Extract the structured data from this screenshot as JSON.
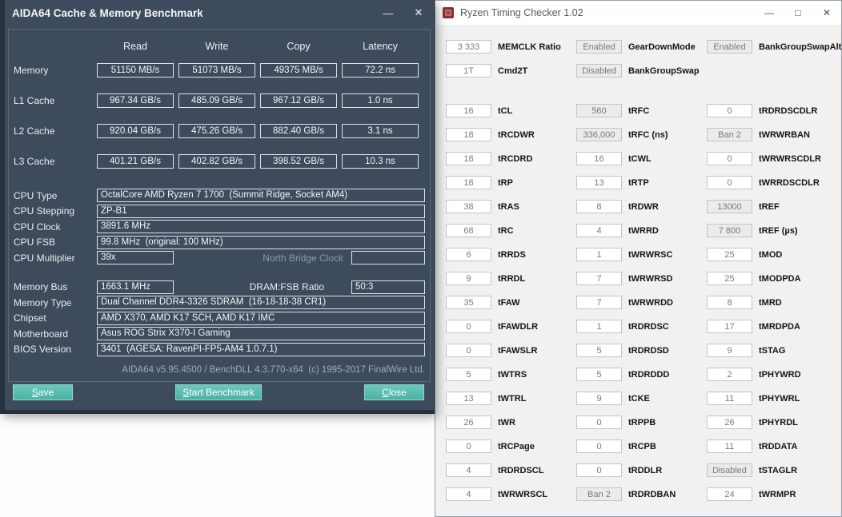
{
  "aida": {
    "title": "AIDA64 Cache & Memory Benchmark",
    "window_controls": {
      "minimize": "—",
      "close": "✕"
    },
    "columns": [
      "Read",
      "Write",
      "Copy",
      "Latency"
    ],
    "bench_rows": [
      {
        "label": "Memory",
        "read": "51150 MB/s",
        "write": "51073 MB/s",
        "copy": "49375 MB/s",
        "latency": "72.2 ns"
      },
      {
        "label": "L1 Cache",
        "read": "967.34 GB/s",
        "write": "485.09 GB/s",
        "copy": "967.12 GB/s",
        "latency": "1.0 ns"
      },
      {
        "label": "L2 Cache",
        "read": "920.04 GB/s",
        "write": "475.26 GB/s",
        "copy": "882.40 GB/s",
        "latency": "3.1 ns"
      },
      {
        "label": "L3 Cache",
        "read": "401.21 GB/s",
        "write": "402.82 GB/s",
        "copy": "398.52 GB/s",
        "latency": "10.3 ns"
      }
    ],
    "info_rows_a": [
      {
        "label": "CPU Type",
        "value": "OctalCore AMD Ryzen 7 1700  (Summit Ridge, Socket AM4)"
      },
      {
        "label": "CPU Stepping",
        "value": "ZP-B1"
      },
      {
        "label": "CPU Clock",
        "value": "3891.6 MHz"
      },
      {
        "label": "CPU FSB",
        "value": "99.8 MHz  (original: 100 MHz)"
      }
    ],
    "multiplier_row": {
      "label": "CPU Multiplier",
      "value": "39x",
      "nb_label": "North Bridge Clock",
      "nb_value": ""
    },
    "membus_row": {
      "label": "Memory Bus",
      "value": "1663.1 MHz",
      "ratio_label": "DRAM:FSB Ratio",
      "ratio_value": "50:3"
    },
    "info_rows_b": [
      {
        "label": "Memory Type",
        "value": "Dual Channel DDR4-3326 SDRAM  (16-18-18-38 CR1)"
      },
      {
        "label": "Chipset",
        "value": "AMD X370, AMD K17 SCH, AMD K17 IMC"
      },
      {
        "label": "Motherboard",
        "value": "Asus ROG Strix X370-I Gaming"
      },
      {
        "label": "BIOS Version",
        "value": "3401  (AGESA: RavenPI-FP5-AM4 1.0.7.1)"
      }
    ],
    "footer": "AIDA64 v5.95.4500 / BenchDLL 4.3.770-x64  (c) 1995-2017 FinalWire Ltd.",
    "buttons": {
      "save": "Save",
      "start": "Start Benchmark",
      "close": "Close"
    },
    "colors": {
      "window_bg": "#3d4b5c",
      "button_teal": "#4cb1a4",
      "box_border": "#e0e5ea"
    }
  },
  "rtc": {
    "title": "Ryzen Timing Checker 1.02",
    "window_controls": {
      "minimize": "—",
      "maximize": "□",
      "close": "✕"
    },
    "colors": {
      "titlebar_bg": "#ffffff",
      "body_bg": "#f1f1f1",
      "muted_box": "#ebebeb"
    },
    "top_col1": [
      {
        "value": "3 333",
        "label": "MEMCLK Ratio"
      },
      {
        "value": "1T",
        "label": "Cmd2T"
      }
    ],
    "top_col2": [
      {
        "value": "Enabled",
        "label": "GearDownMode",
        "muted": true
      },
      {
        "value": "Disabled",
        "label": "BankGroupSwap",
        "muted": true
      }
    ],
    "top_col3": [
      {
        "value": "Enabled",
        "label": "BankGroupSwapAlt",
        "muted": true
      }
    ],
    "col1": [
      {
        "value": "16",
        "label": "tCL"
      },
      {
        "value": "18",
        "label": "tRCDWR"
      },
      {
        "value": "18",
        "label": "tRCDRD"
      },
      {
        "value": "18",
        "label": "tRP"
      },
      {
        "value": "38",
        "label": "tRAS"
      },
      {
        "value": "68",
        "label": "tRC"
      },
      {
        "value": "6",
        "label": "tRRDS"
      },
      {
        "value": "9",
        "label": "tRRDL"
      },
      {
        "value": "35",
        "label": "tFAW"
      },
      {
        "value": "0",
        "label": "tFAWDLR"
      },
      {
        "value": "0",
        "label": "tFAWSLR"
      },
      {
        "value": "5",
        "label": "tWTRS"
      },
      {
        "value": "13",
        "label": "tWTRL"
      },
      {
        "value": "26",
        "label": "tWR"
      },
      {
        "value": "0",
        "label": "tRCPage"
      },
      {
        "value": "4",
        "label": "tRDRDSCL"
      },
      {
        "value": "4",
        "label": "tWRWRSCL"
      }
    ],
    "col2": [
      {
        "value": "560",
        "label": "tRFC",
        "muted": true
      },
      {
        "value": "336,000",
        "label": "tRFC (ns)",
        "muted": true
      },
      {
        "value": "16",
        "label": "tCWL"
      },
      {
        "value": "13",
        "label": "tRTP"
      },
      {
        "value": "8",
        "label": "tRDWR"
      },
      {
        "value": "4",
        "label": "tWRRD"
      },
      {
        "value": "1",
        "label": "tWRWRSC"
      },
      {
        "value": "7",
        "label": "tWRWRSD"
      },
      {
        "value": "7",
        "label": "tWRWRDD"
      },
      {
        "value": "1",
        "label": "tRDRDSC"
      },
      {
        "value": "5",
        "label": "tRDRDSD"
      },
      {
        "value": "5",
        "label": "tRDRDDD"
      },
      {
        "value": "9",
        "label": "tCKE"
      },
      {
        "value": "0",
        "label": "tRPPB"
      },
      {
        "value": "0",
        "label": "tRCPB"
      },
      {
        "value": "0",
        "label": "tRDDLR"
      },
      {
        "value": "Ban 2",
        "label": "tRDRDBAN",
        "muted": true
      }
    ],
    "col3": [
      {
        "value": "0",
        "label": "tRDRDSCDLR"
      },
      {
        "value": "Ban 2",
        "label": "tWRWRBAN",
        "muted": true
      },
      {
        "value": "0",
        "label": "tWRWRSCDLR"
      },
      {
        "value": "0",
        "label": "tWRRDSCDLR"
      },
      {
        "value": "13000",
        "label": "tREF",
        "muted": true
      },
      {
        "value": "7 800",
        "label": "tREF (µs)",
        "muted": true
      },
      {
        "value": "25",
        "label": "tMOD"
      },
      {
        "value": "25",
        "label": "tMODPDA"
      },
      {
        "value": "8",
        "label": "tMRD"
      },
      {
        "value": "17",
        "label": "tMRDPDA"
      },
      {
        "value": "9",
        "label": "tSTAG"
      },
      {
        "value": "2",
        "label": "tPHYWRD"
      },
      {
        "value": "11",
        "label": "tPHYWRL"
      },
      {
        "value": "26",
        "label": "tPHYRDL"
      },
      {
        "value": "11",
        "label": "tRDDATA"
      },
      {
        "value": "Disabled",
        "label": "tSTAGLR",
        "muted": true
      },
      {
        "value": "24",
        "label": "tWRMPR"
      }
    ]
  }
}
